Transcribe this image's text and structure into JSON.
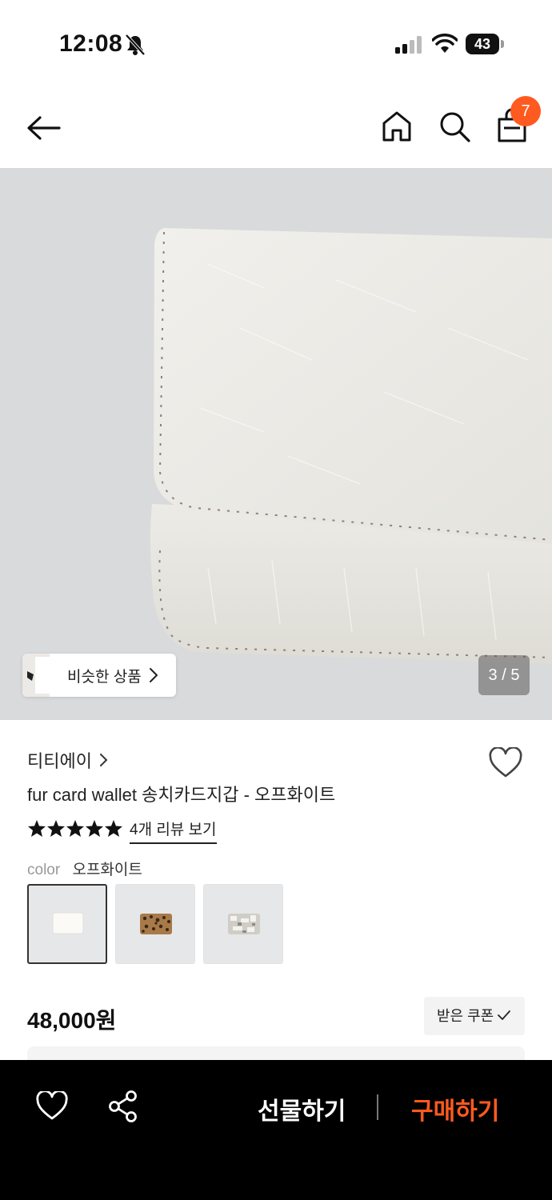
{
  "status_bar": {
    "time": "12:08",
    "battery": "43"
  },
  "nav": {
    "cart_count": "7",
    "icons": [
      "back-arrow-icon",
      "home-icon",
      "search-icon",
      "shopping-bag-icon"
    ]
  },
  "gallery": {
    "similar_label": "비슷한 상품",
    "page_indicator": "3 / 5",
    "current_page": 3,
    "total_pages": 5
  },
  "product": {
    "brand": "티티에이",
    "title": "fur card wallet 송치카드지갑 - 오프화이트",
    "rating_stars": 5,
    "review_link": "4개 리뷰 보기",
    "option_key": "color",
    "option_value": "오프화이트",
    "swatches": [
      "오프화이트",
      "레오파드",
      "실버"
    ],
    "selected_swatch": 0,
    "price": "48,000원",
    "coupon_label": "받은 쿠폰"
  },
  "bottom_bar": {
    "gift_label": "선물하기",
    "buy_label": "구매하기"
  },
  "colors": {
    "accent": "#ff5a1f",
    "bottom_bar": "#000000",
    "hero_background": "#d9dadb"
  }
}
